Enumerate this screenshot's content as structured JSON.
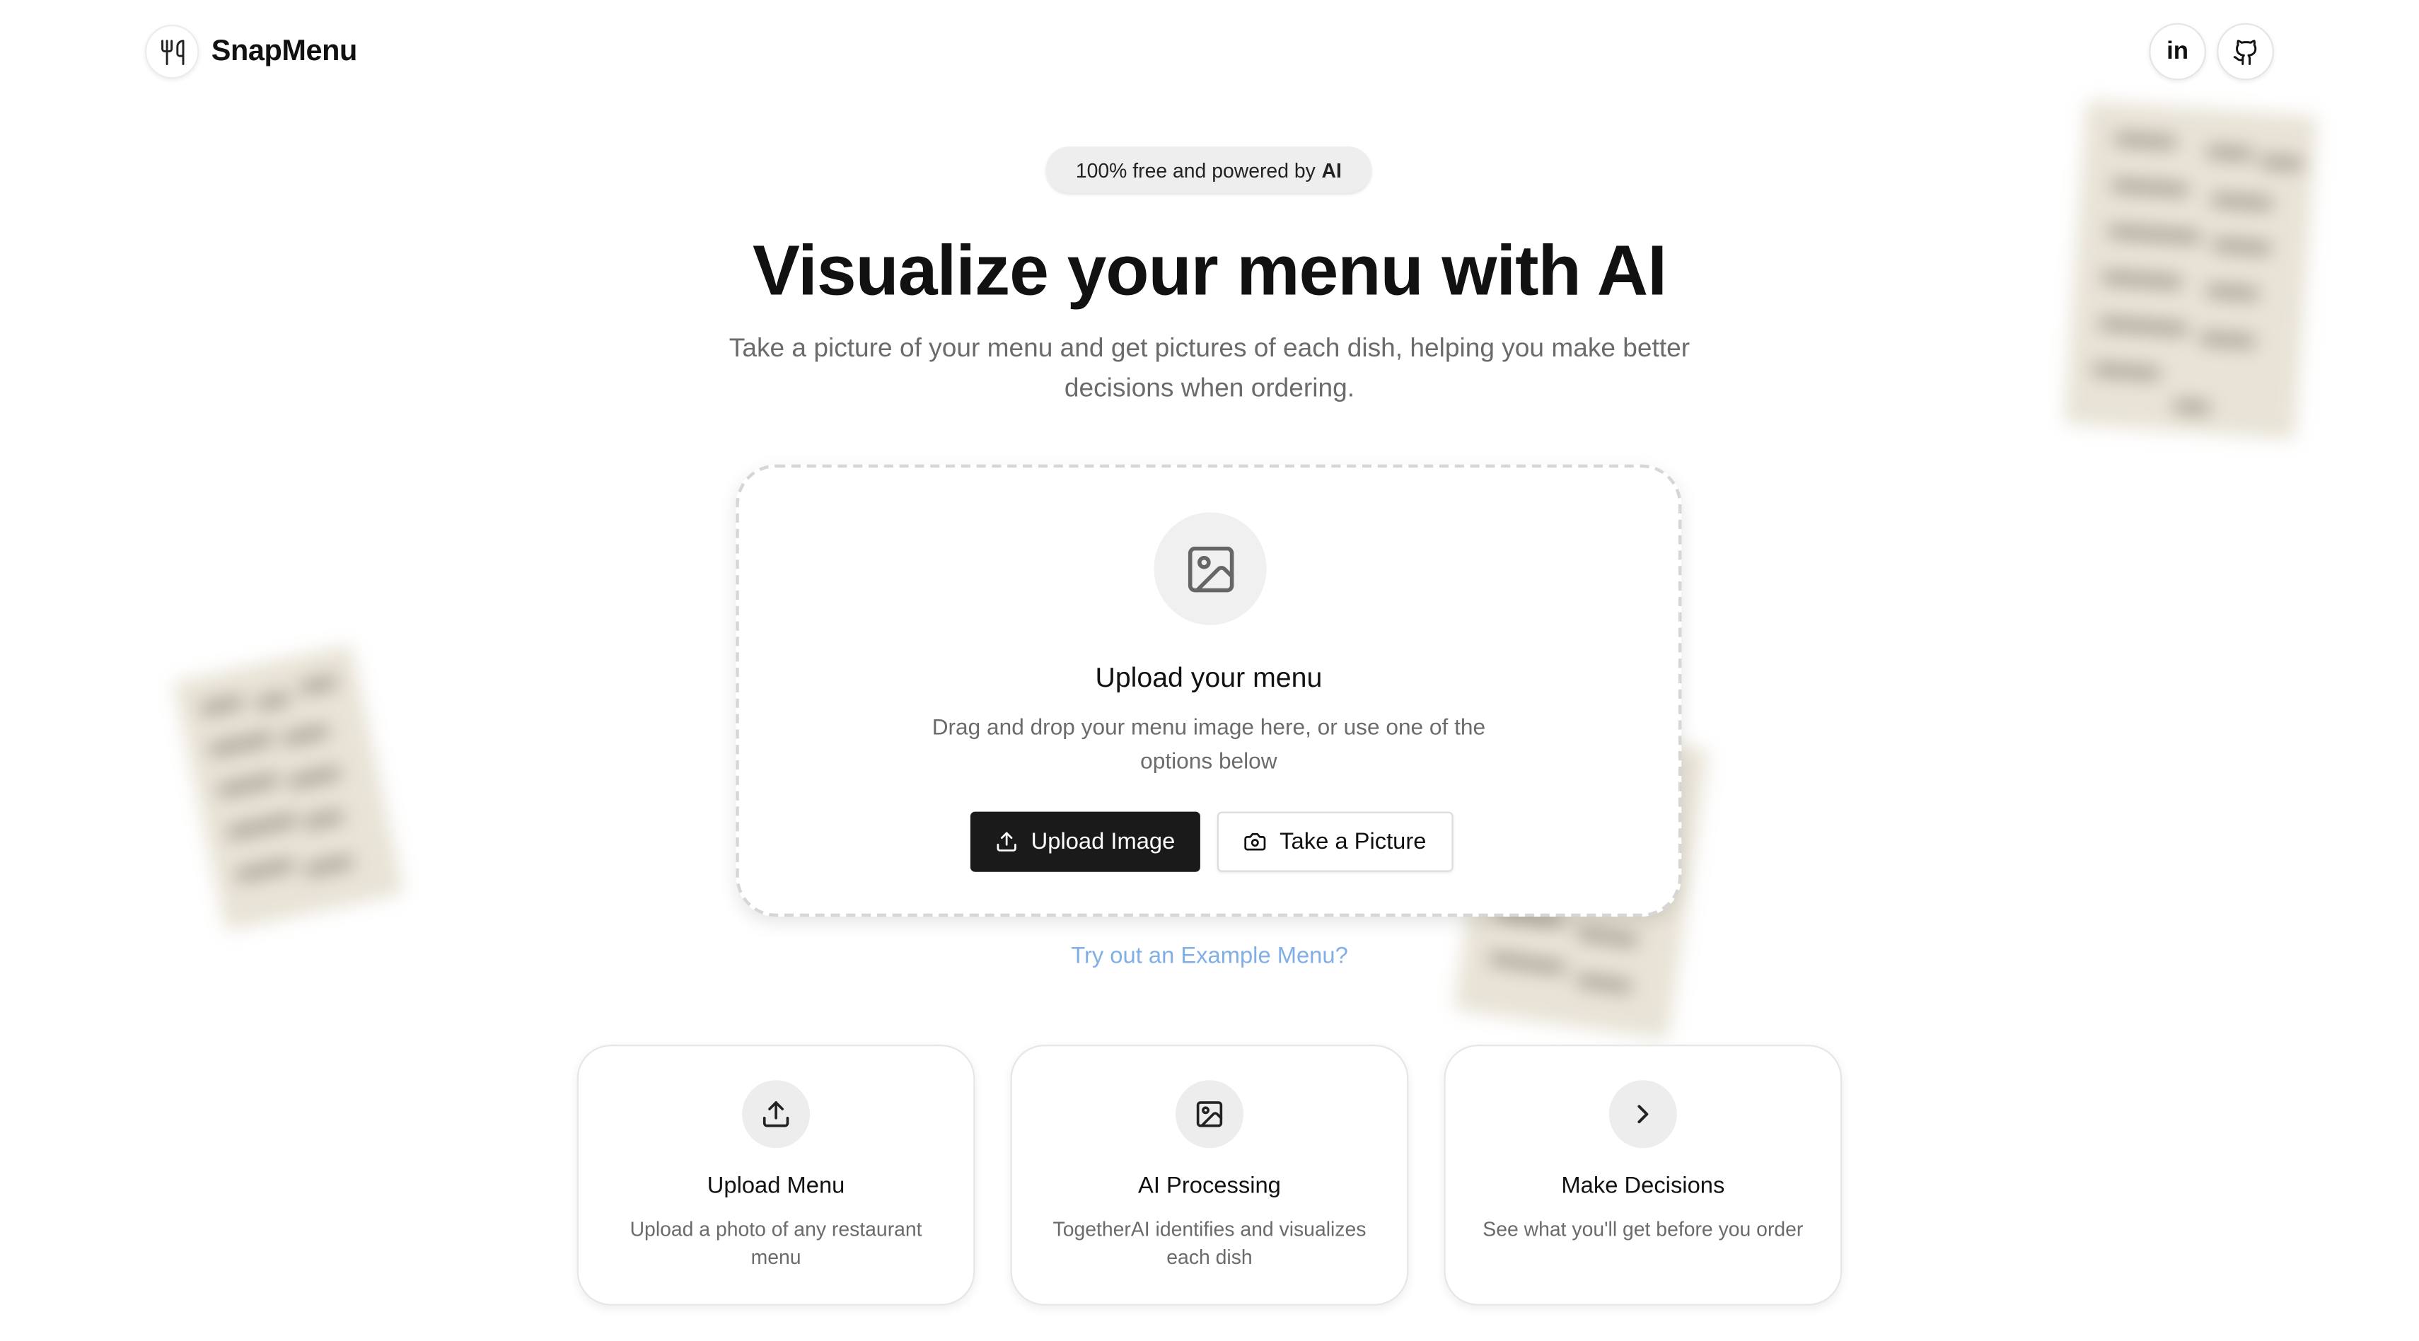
{
  "header": {
    "logo_text": "SnapMenu",
    "logo_icon": "utensils-icon",
    "social": [
      {
        "label": "in",
        "icon": "linkedin-icon"
      },
      {
        "label": "",
        "icon": "github-icon"
      }
    ]
  },
  "hero": {
    "pill_prefix": "100% free and powered by",
    "pill_bold": "AI",
    "headline": "Visualize your menu with AI",
    "subhead": "Take a picture of your menu and get pictures of each dish, helping you make better decisions when ordering."
  },
  "upload": {
    "icon": "image-icon",
    "title": "Upload your menu",
    "description": "Drag and drop your menu image here, or use one of the options below",
    "upload_button": "Upload Image",
    "camera_button": "Take a Picture",
    "example_link": "Try out an Example Menu?"
  },
  "features": [
    {
      "icon": "upload-icon",
      "title": "Upload Menu",
      "description": "Upload a photo of any restaurant menu"
    },
    {
      "icon": "image-icon",
      "title": "AI Processing",
      "description": "TogetherAI identifies and visualizes each dish"
    },
    {
      "icon": "chevron-right-icon",
      "title": "Make Decisions",
      "description": "See what you'll get before you order"
    }
  ],
  "colors": {
    "primary_button": "#1a1a1a",
    "link": "#80aee6",
    "muted_text": "#6b6b6b"
  }
}
